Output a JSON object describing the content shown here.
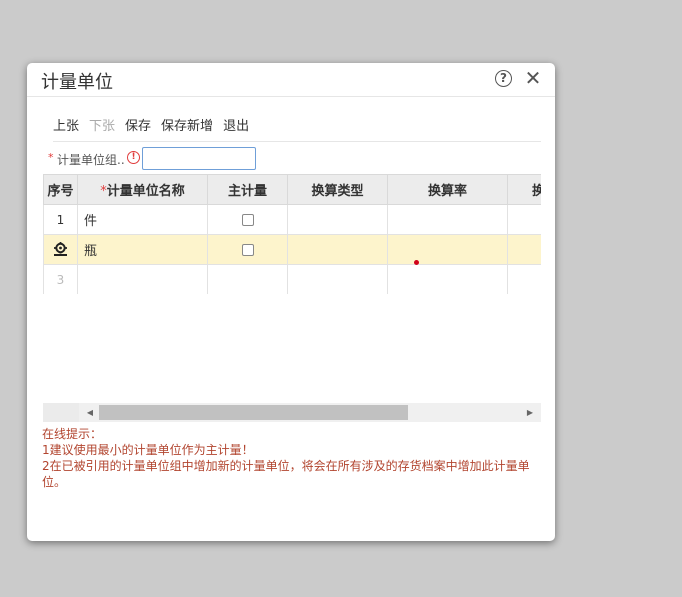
{
  "dialog": {
    "title": "计量单位",
    "help_icon": "question-circle-icon",
    "close_icon": "close-x-icon"
  },
  "toolbar": {
    "items": [
      {
        "label": "上张",
        "enabled": true
      },
      {
        "label": "下张",
        "enabled": false
      },
      {
        "label": "保存",
        "enabled": true
      },
      {
        "label": "保存新增",
        "enabled": true
      },
      {
        "label": "退出",
        "enabled": true
      }
    ]
  },
  "form": {
    "required_mark": "*",
    "group_label": "计量单位组..",
    "group_value": "",
    "warning_icon": "exclamation-circle-icon"
  },
  "grid": {
    "columns": [
      "序号",
      "计量单位名称",
      "主计量",
      "换算类型",
      "换算率",
      "换"
    ],
    "required_mark": "*",
    "rows": [
      {
        "no": "1",
        "name": "件",
        "main": false,
        "type": "",
        "rate": ""
      },
      {
        "no": "",
        "name": "瓶",
        "main": false,
        "type": "",
        "rate": "",
        "selected": true,
        "icon": "gear-icon"
      },
      {
        "no": "3",
        "name": "",
        "type": "",
        "rate": ""
      }
    ]
  },
  "scrollbar": {
    "left_icon": "arrow-left-icon",
    "right_icon": "arrow-right-icon"
  },
  "hints": {
    "title": "在线提示：",
    "line1": "1建议使用最小的计量单位作为主计量！",
    "line2": "2在已被引用的计量单位组中增加新的计量单位，将会在所有涉及的存货档案中增加此计量单位。"
  },
  "colors": {
    "selected_row": "#fdf4cc",
    "hint_text": "#b2452f",
    "required": "#e03b3b"
  }
}
